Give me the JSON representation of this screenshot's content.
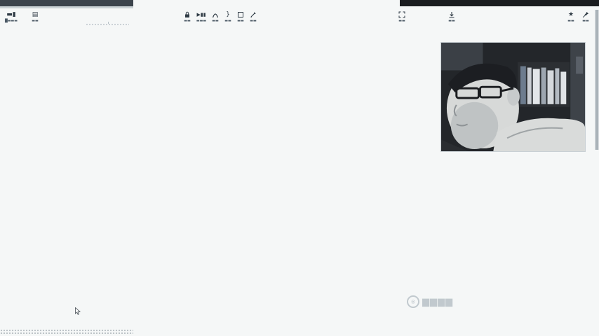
{
  "toolbar": {
    "left": [
      {
        "id": "tool-a",
        "glyph": "▬▮",
        "label": "█▬▬▬"
      },
      {
        "id": "tool-b",
        "glyph": "▤",
        "label": "▬▬"
      }
    ],
    "center": [
      {
        "id": "tool-lock",
        "glyph": "lock-icon",
        "label": "▬▬"
      },
      {
        "id": "tool-card",
        "glyph": "▶▮▮",
        "label": "▬▬▬"
      },
      {
        "id": "tool-arc",
        "glyph": "arc-icon",
        "label": "▬▬"
      },
      {
        "id": "tool-brace",
        "glyph": "}",
        "label": "▬▬"
      },
      {
        "id": "tool-rect",
        "glyph": "rect-icon",
        "label": "▬▬"
      },
      {
        "id": "tool-pen",
        "glyph": "pen-icon",
        "label": "▬▬"
      }
    ],
    "right": [
      {
        "id": "tool-expand",
        "glyph": "expand-icon",
        "label": "▬▬"
      },
      {
        "id": "tool-download",
        "glyph": "download-icon",
        "label": "▬▬"
      },
      {
        "id": "tool-star",
        "glyph": "★",
        "label": "▬▬"
      },
      {
        "id": "tool-pin",
        "glyph": "pin-icon",
        "label": "▬▬"
      }
    ]
  },
  "watermark": {
    "logo": "※",
    "text": "▆▆▆▆"
  },
  "colors": {
    "background": "#f5f7f7",
    "toolbar_text": "#2e3a44",
    "webcam_bg": "#1e2024"
  }
}
